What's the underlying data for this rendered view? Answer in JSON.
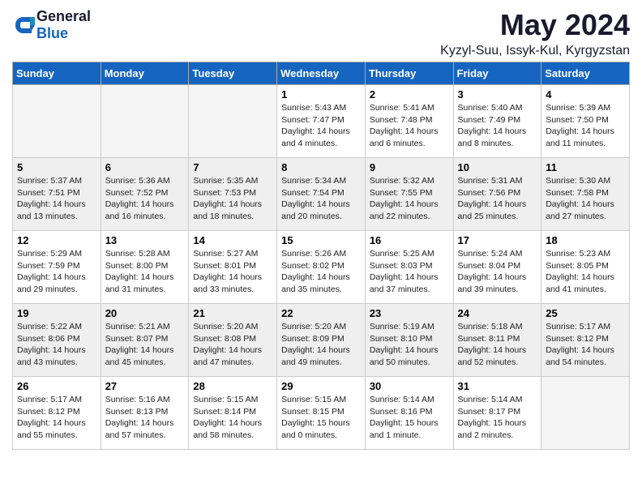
{
  "header": {
    "logo_general": "General",
    "logo_blue": "Blue",
    "title": "May 2024",
    "location": "Kyzyl-Suu, Issyk-Kul, Kyrgyzstan"
  },
  "weekdays": [
    "Sunday",
    "Monday",
    "Tuesday",
    "Wednesday",
    "Thursday",
    "Friday",
    "Saturday"
  ],
  "weeks": [
    [
      {
        "num": "",
        "info": ""
      },
      {
        "num": "",
        "info": ""
      },
      {
        "num": "",
        "info": ""
      },
      {
        "num": "1",
        "info": "Sunrise: 5:43 AM\nSunset: 7:47 PM\nDaylight: 14 hours\nand 4 minutes."
      },
      {
        "num": "2",
        "info": "Sunrise: 5:41 AM\nSunset: 7:48 PM\nDaylight: 14 hours\nand 6 minutes."
      },
      {
        "num": "3",
        "info": "Sunrise: 5:40 AM\nSunset: 7:49 PM\nDaylight: 14 hours\nand 8 minutes."
      },
      {
        "num": "4",
        "info": "Sunrise: 5:39 AM\nSunset: 7:50 PM\nDaylight: 14 hours\nand 11 minutes."
      }
    ],
    [
      {
        "num": "5",
        "info": "Sunrise: 5:37 AM\nSunset: 7:51 PM\nDaylight: 14 hours\nand 13 minutes."
      },
      {
        "num": "6",
        "info": "Sunrise: 5:36 AM\nSunset: 7:52 PM\nDaylight: 14 hours\nand 16 minutes."
      },
      {
        "num": "7",
        "info": "Sunrise: 5:35 AM\nSunset: 7:53 PM\nDaylight: 14 hours\nand 18 minutes."
      },
      {
        "num": "8",
        "info": "Sunrise: 5:34 AM\nSunset: 7:54 PM\nDaylight: 14 hours\nand 20 minutes."
      },
      {
        "num": "9",
        "info": "Sunrise: 5:32 AM\nSunset: 7:55 PM\nDaylight: 14 hours\nand 22 minutes."
      },
      {
        "num": "10",
        "info": "Sunrise: 5:31 AM\nSunset: 7:56 PM\nDaylight: 14 hours\nand 25 minutes."
      },
      {
        "num": "11",
        "info": "Sunrise: 5:30 AM\nSunset: 7:58 PM\nDaylight: 14 hours\nand 27 minutes."
      }
    ],
    [
      {
        "num": "12",
        "info": "Sunrise: 5:29 AM\nSunset: 7:59 PM\nDaylight: 14 hours\nand 29 minutes."
      },
      {
        "num": "13",
        "info": "Sunrise: 5:28 AM\nSunset: 8:00 PM\nDaylight: 14 hours\nand 31 minutes."
      },
      {
        "num": "14",
        "info": "Sunrise: 5:27 AM\nSunset: 8:01 PM\nDaylight: 14 hours\nand 33 minutes."
      },
      {
        "num": "15",
        "info": "Sunrise: 5:26 AM\nSunset: 8:02 PM\nDaylight: 14 hours\nand 35 minutes."
      },
      {
        "num": "16",
        "info": "Sunrise: 5:25 AM\nSunset: 8:03 PM\nDaylight: 14 hours\nand 37 minutes."
      },
      {
        "num": "17",
        "info": "Sunrise: 5:24 AM\nSunset: 8:04 PM\nDaylight: 14 hours\nand 39 minutes."
      },
      {
        "num": "18",
        "info": "Sunrise: 5:23 AM\nSunset: 8:05 PM\nDaylight: 14 hours\nand 41 minutes."
      }
    ],
    [
      {
        "num": "19",
        "info": "Sunrise: 5:22 AM\nSunset: 8:06 PM\nDaylight: 14 hours\nand 43 minutes."
      },
      {
        "num": "20",
        "info": "Sunrise: 5:21 AM\nSunset: 8:07 PM\nDaylight: 14 hours\nand 45 minutes."
      },
      {
        "num": "21",
        "info": "Sunrise: 5:20 AM\nSunset: 8:08 PM\nDaylight: 14 hours\nand 47 minutes."
      },
      {
        "num": "22",
        "info": "Sunrise: 5:20 AM\nSunset: 8:09 PM\nDaylight: 14 hours\nand 49 minutes."
      },
      {
        "num": "23",
        "info": "Sunrise: 5:19 AM\nSunset: 8:10 PM\nDaylight: 14 hours\nand 50 minutes."
      },
      {
        "num": "24",
        "info": "Sunrise: 5:18 AM\nSunset: 8:11 PM\nDaylight: 14 hours\nand 52 minutes."
      },
      {
        "num": "25",
        "info": "Sunrise: 5:17 AM\nSunset: 8:12 PM\nDaylight: 14 hours\nand 54 minutes."
      }
    ],
    [
      {
        "num": "26",
        "info": "Sunrise: 5:17 AM\nSunset: 8:12 PM\nDaylight: 14 hours\nand 55 minutes."
      },
      {
        "num": "27",
        "info": "Sunrise: 5:16 AM\nSunset: 8:13 PM\nDaylight: 14 hours\nand 57 minutes."
      },
      {
        "num": "28",
        "info": "Sunrise: 5:15 AM\nSunset: 8:14 PM\nDaylight: 14 hours\nand 58 minutes."
      },
      {
        "num": "29",
        "info": "Sunrise: 5:15 AM\nSunset: 8:15 PM\nDaylight: 15 hours\nand 0 minutes."
      },
      {
        "num": "30",
        "info": "Sunrise: 5:14 AM\nSunset: 8:16 PM\nDaylight: 15 hours\nand 1 minute."
      },
      {
        "num": "31",
        "info": "Sunrise: 5:14 AM\nSunset: 8:17 PM\nDaylight: 15 hours\nand 2 minutes."
      },
      {
        "num": "",
        "info": ""
      }
    ]
  ]
}
